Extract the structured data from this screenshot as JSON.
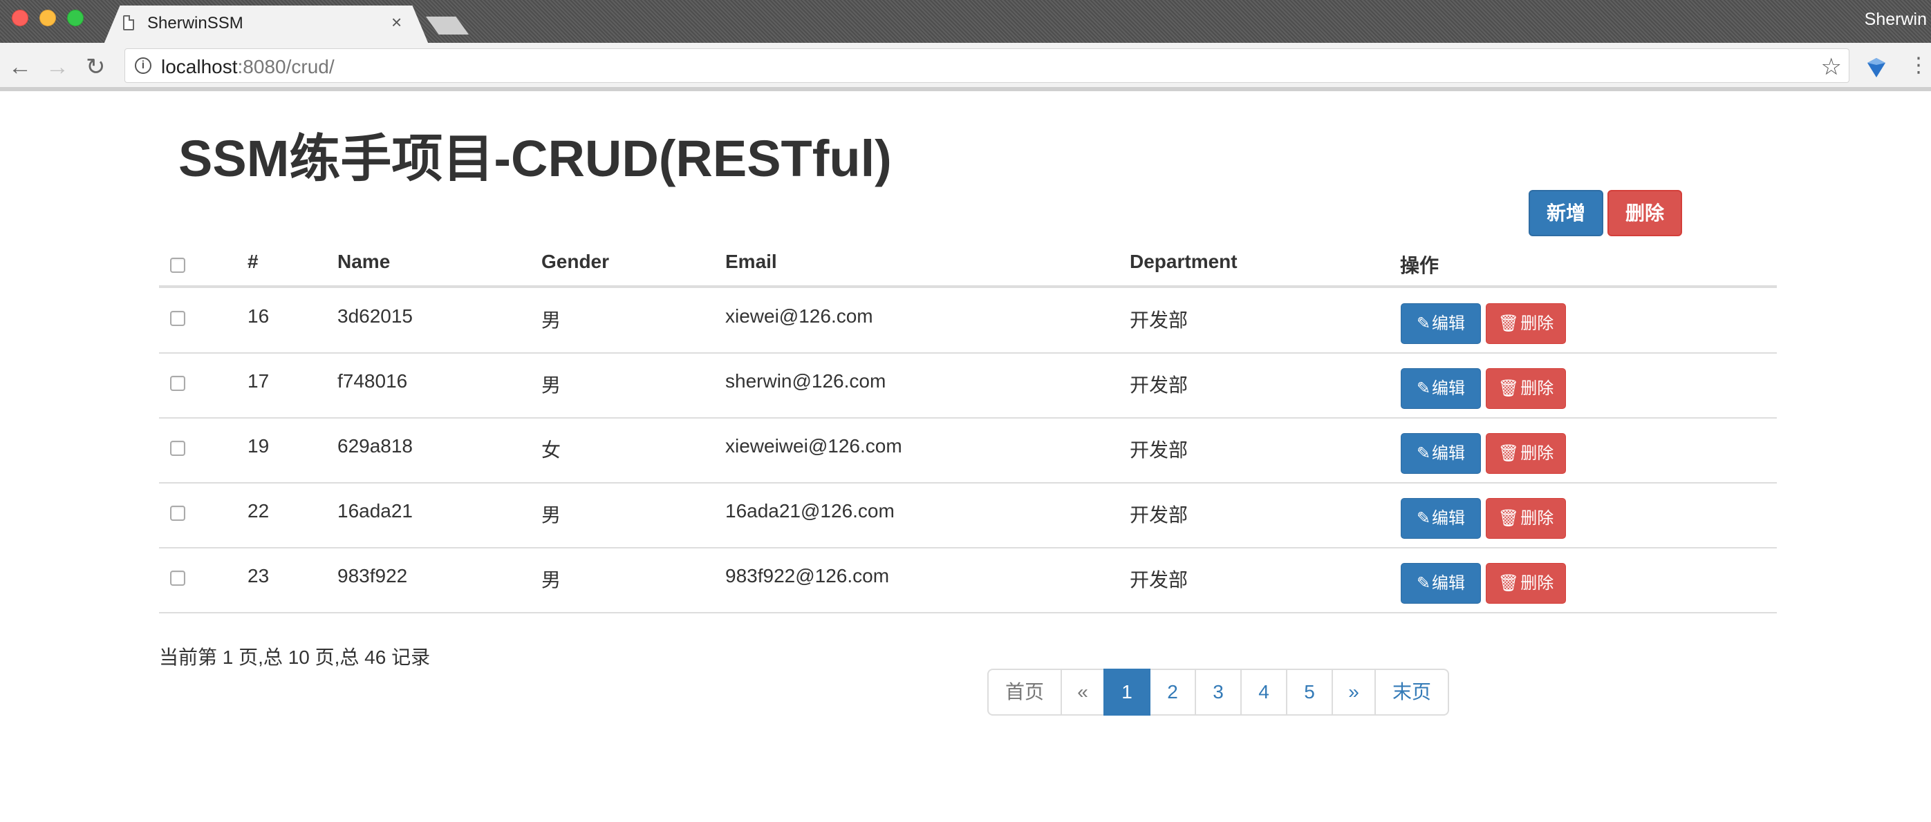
{
  "browser": {
    "tab_title": "SherwinSSM",
    "tab_close": "×",
    "user": "Sherwin",
    "url_host": "localhost",
    "url_rest": ":8080/crud/"
  },
  "page": {
    "title": "SSM练手项目-CRUD(RESTful)",
    "add_button": "新增",
    "delete_button": "删除"
  },
  "table": {
    "columns": [
      "#",
      "Name",
      "Gender",
      "Email",
      "Department",
      "操作"
    ],
    "edit_label": "编辑",
    "remove_label": "删除",
    "rows": [
      {
        "id": "16",
        "name": "3d62015",
        "gender": "男",
        "email": "xiewei@126.com",
        "department": "开发部"
      },
      {
        "id": "17",
        "name": "f748016",
        "gender": "男",
        "email": "sherwin@126.com",
        "department": "开发部"
      },
      {
        "id": "19",
        "name": "629a818",
        "gender": "女",
        "email": "xieweiwei@126.com",
        "department": "开发部"
      },
      {
        "id": "22",
        "name": "16ada21",
        "gender": "男",
        "email": "16ada21@126.com",
        "department": "开发部"
      },
      {
        "id": "23",
        "name": "983f922",
        "gender": "男",
        "email": "983f922@126.com",
        "department": "开发部"
      }
    ]
  },
  "pagination": {
    "info": "当前第 1 页,总 10 页,总 46 记录",
    "first": "首页",
    "prev": "«",
    "pages": [
      "1",
      "2",
      "3",
      "4",
      "5"
    ],
    "active_page": "1",
    "next": "»",
    "last": "末页"
  },
  "colors": {
    "primary": "#337ab7",
    "danger": "#d9534f"
  }
}
